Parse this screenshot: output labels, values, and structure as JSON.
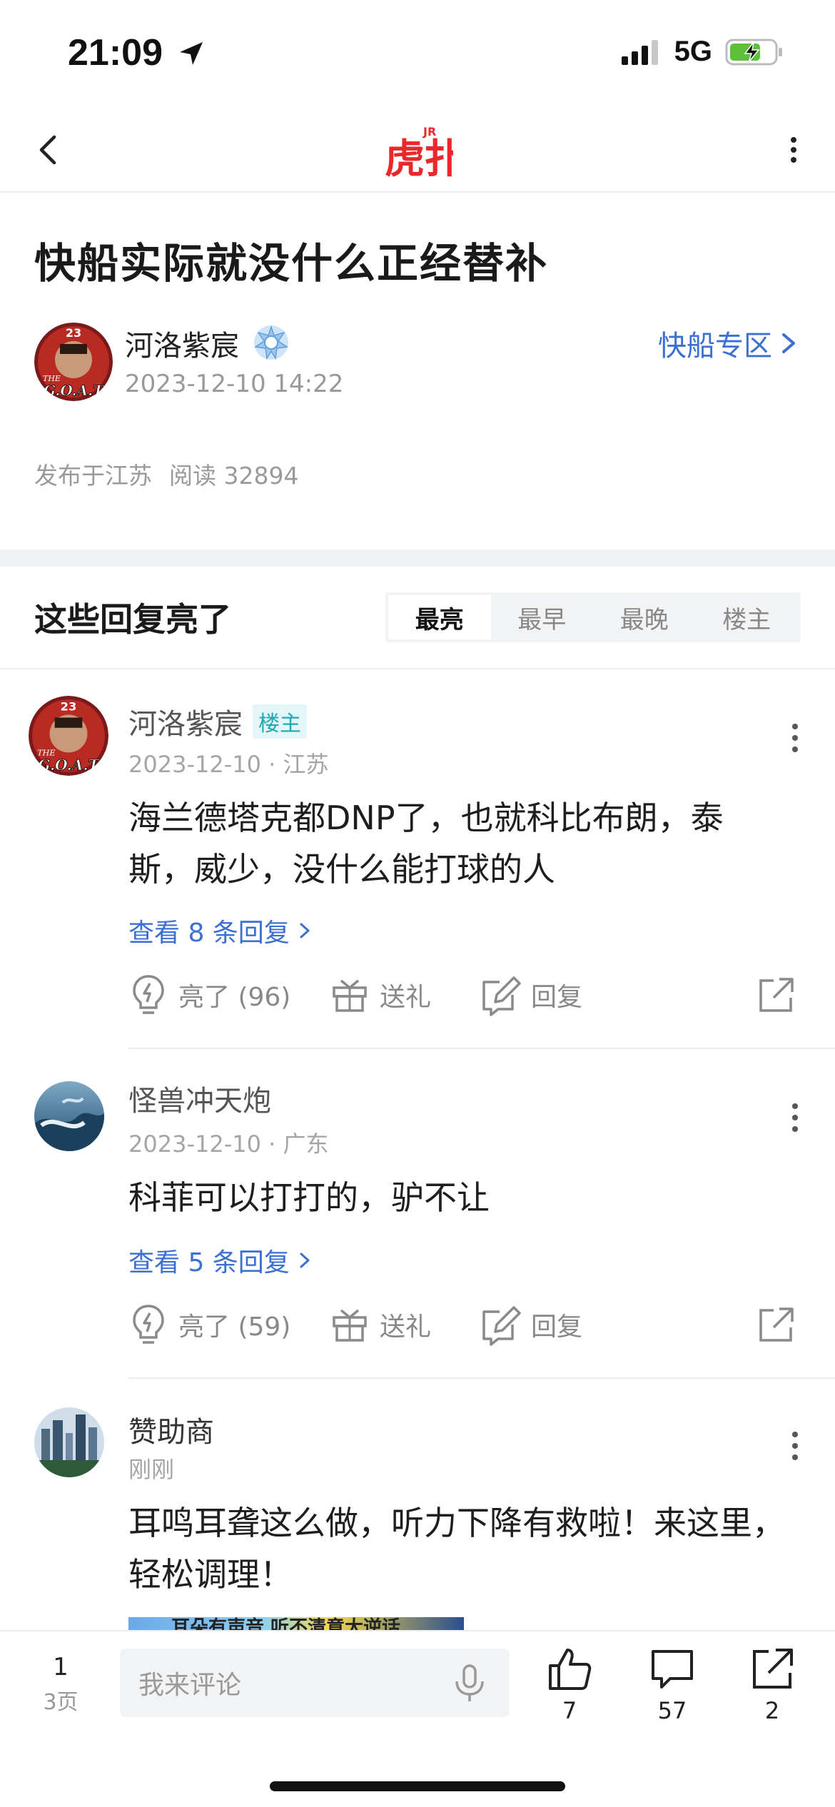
{
  "status_bar": {
    "time": "21:09",
    "network": "5G"
  },
  "nav": {
    "logo_main": "虎扑",
    "logo_sup": "JR"
  },
  "post": {
    "title": "快船实际就没什么正经替补",
    "author_name": "河洛紫宸",
    "avatar_text_top": "23",
    "avatar_text_bottom": "G.O.A.T",
    "avatar_text_the": "THE",
    "time": "2023-12-10 14:22",
    "section_link": "快船专区",
    "location": "发布于江苏",
    "reads": "阅读 32894"
  },
  "replies": {
    "header": "这些回复亮了",
    "tabs": [
      {
        "label": "最亮",
        "active": true
      },
      {
        "label": "最早",
        "active": false
      },
      {
        "label": "最晚",
        "active": false
      },
      {
        "label": "楼主",
        "active": false
      }
    ],
    "actions": {
      "gift": "送礼",
      "reply": "回复"
    },
    "comments": [
      {
        "name": "河洛紫宸",
        "op_badge": "楼主",
        "meta": "2023-12-10 · 江苏",
        "text": "海兰德塔克都DNP了，也就科比布朗，泰斯，威少，没什么能打球的人",
        "view_replies": "查看 8 条回复",
        "like_label": "亮了 (96)"
      },
      {
        "name": "怪兽冲天炮",
        "meta": "2023-12-10 · 广东",
        "text": "科菲可以打打的，驴不让",
        "view_replies": "查看 5 条回复",
        "like_label": "亮了 (59)"
      },
      {
        "name": "赞助商",
        "meta": "刚刚",
        "text": "耳鸣耳聋这么做，听力下降有救啦！来这里，轻松调理！",
        "ad_banner_text": "耳朵有声音 听不清意大逆话"
      }
    ]
  },
  "bottom_bar": {
    "page_current": "1",
    "page_total": "3页",
    "input_placeholder": "我来评论",
    "likes": "7",
    "comments": "57",
    "shares": "2"
  },
  "colors": {
    "accent_blue": "#3b6fd1",
    "brand_red": "#e8282b",
    "op_teal": "#20a8b3"
  }
}
